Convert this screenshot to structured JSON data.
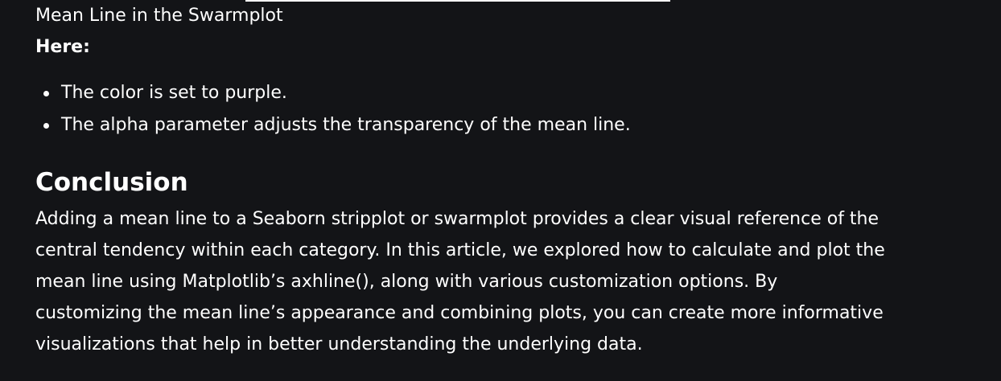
{
  "caption": "Mean Line in the Swarmplot",
  "lead": "Here:",
  "bullets": [
    "The color is set to purple.",
    "The alpha parameter adjusts the transparency of the mean line."
  ],
  "conclusion": {
    "heading": "Conclusion",
    "paragraph": "Adding a mean line to a Seaborn stripplot or swarmplot provides a clear visual reference of the central tendency within each category. In this article, we explored how to calculate and plot the mean line using Matplotlib’s axhline(), along with various customization options. By customizing the mean line’s appearance and combining plots, you can create more informative visualizations that help in better understanding the underlying data."
  }
}
